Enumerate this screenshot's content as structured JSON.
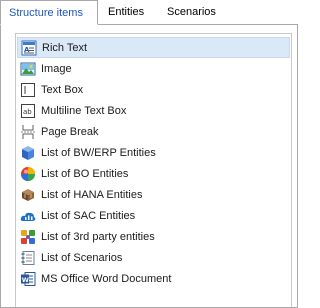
{
  "tabs": [
    {
      "label": "Structure items",
      "active": true
    },
    {
      "label": "Entities",
      "active": false
    },
    {
      "label": "Scenarios",
      "active": false
    }
  ],
  "items": [
    {
      "label": "Rich Text",
      "icon": "rich-text-icon",
      "selected": true
    },
    {
      "label": "Image",
      "icon": "image-icon"
    },
    {
      "label": "Text Box",
      "icon": "text-box-icon"
    },
    {
      "label": "Multiline Text Box",
      "icon": "multiline-text-box-icon"
    },
    {
      "label": "Page Break",
      "icon": "page-break-icon"
    },
    {
      "label": "List of BW/ERP Entities",
      "icon": "bw-erp-cube-icon"
    },
    {
      "label": "List of BO Entities",
      "icon": "bo-globe-icon"
    },
    {
      "label": "List of HANA Entities",
      "icon": "hana-icon"
    },
    {
      "label": "List of SAC Entities",
      "icon": "sac-cloud-icon"
    },
    {
      "label": "List of 3rd party entities",
      "icon": "third-party-icon"
    },
    {
      "label": "List of Scenarios",
      "icon": "scenarios-icon"
    },
    {
      "label": "MS Office Word Document",
      "icon": "word-document-icon"
    }
  ],
  "colors": {
    "accent": "#1e57b8",
    "selected_row": "#dbe8f7",
    "border": "#a9a9a9"
  }
}
